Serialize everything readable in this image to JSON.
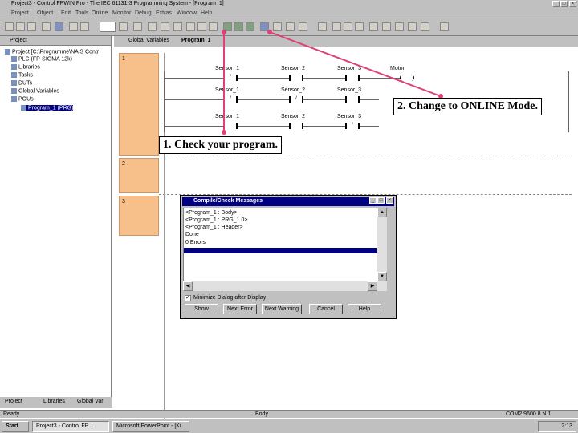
{
  "window": {
    "title": "Project3 - Control FPWIN Pro - The IEC 61131-3 Programming System - [Program_1]"
  },
  "menu": {
    "items": [
      "Project",
      "Object",
      "Edit",
      "Tools",
      "Online",
      "Monitor",
      "Debug",
      "Extras",
      "Window",
      "Help"
    ]
  },
  "tree": {
    "header": "Project",
    "items": [
      {
        "label": "Project [C:\\Programme\\NAiS Contr"
      },
      {
        "label": "PLC (FP-SIGMA 12k)"
      },
      {
        "label": "Libraries"
      },
      {
        "label": "Tasks"
      },
      {
        "label": "DUTs"
      },
      {
        "label": "Global Variables"
      },
      {
        "label": "POUs"
      },
      {
        "label": "Program_1 (PRG)"
      }
    ],
    "tabs": [
      "Project",
      "Libraries",
      "Global Var"
    ]
  },
  "editor": {
    "tabs": [
      "Global Variables",
      "Program_1"
    ],
    "rows": [
      "1",
      "2",
      "3"
    ],
    "ladder": {
      "rung1_labels": [
        "Sensor_1",
        "Sensor_2",
        "Sensor_3",
        "Motor"
      ],
      "rung2_labels": [
        "Sensor_1",
        "Sensor_2",
        "Sensor_3"
      ],
      "rung3_labels": [
        "Sensor_1",
        "Sensor_2",
        "Sensor_3"
      ]
    }
  },
  "dialog": {
    "title": "Compile/Check Messages",
    "messages": [
      "<Program_1 : Body>",
      "<Program_1 : PRG_1.0>",
      "<Program_1 : Header>",
      "Done",
      "0 Errors"
    ],
    "checkbox_label": "Minimize Dialog after Display",
    "buttons": [
      "Show",
      "Next Error",
      "Next Warning",
      "Cancel",
      "Help"
    ]
  },
  "callouts": {
    "check": "1. Check your program.",
    "online": "2. Change to ONLINE Mode."
  },
  "statusbar": {
    "left": "Ready",
    "middle": "Body",
    "right": "COM2 9600 8 N 1"
  },
  "taskbar": {
    "start": "Start",
    "tasks": [
      "Project3 - Control FP...",
      "Microsoft PowerPoint - [Ki"
    ],
    "clock": "2:13"
  },
  "colors": {
    "row_highlight": "#f7c08a",
    "callout_arrow": "#e0407a",
    "title_active": "#000080"
  }
}
